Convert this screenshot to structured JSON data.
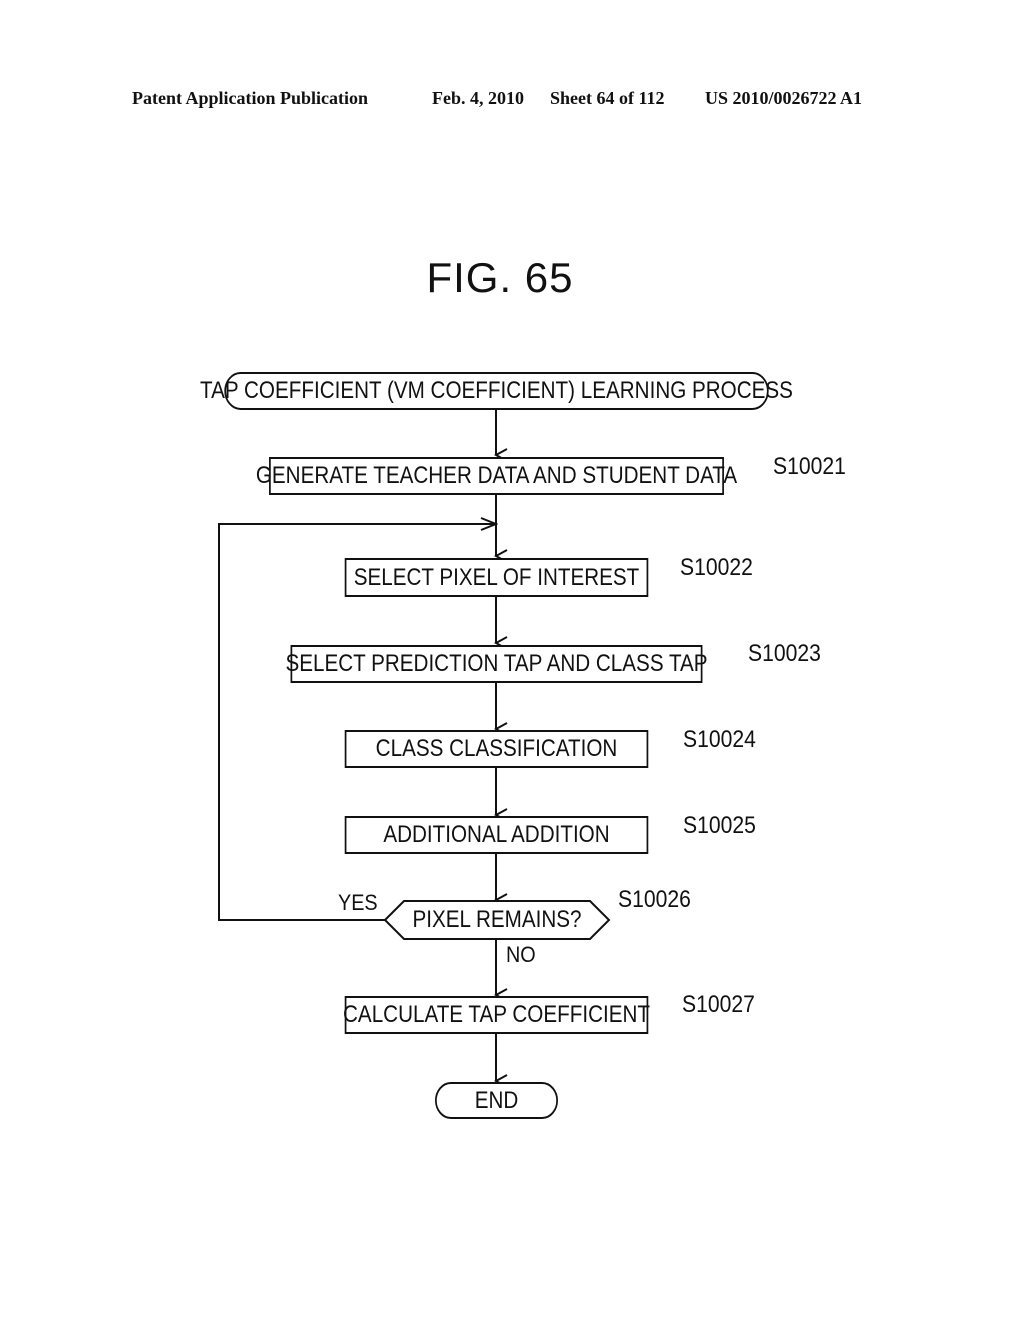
{
  "header": {
    "publication": "Patent Application Publication",
    "date": "Feb. 4, 2010",
    "sheet": "Sheet 64 of 112",
    "number": "US 2010/0026722 A1"
  },
  "figure": {
    "title": "FIG. 65",
    "start": "TAP COEFFICIENT (VM COEFFICIENT) LEARNING PROCESS",
    "end": "END",
    "steps": [
      {
        "id": "S10021",
        "text": "GENERATE TEACHER DATA AND STUDENT DATA"
      },
      {
        "id": "S10022",
        "text": "SELECT PIXEL OF INTEREST"
      },
      {
        "id": "S10023",
        "text": "SELECT PREDICTION TAP AND CLASS TAP"
      },
      {
        "id": "S10024",
        "text": "CLASS CLASSIFICATION"
      },
      {
        "id": "S10025",
        "text": "ADDITIONAL ADDITION"
      },
      {
        "id": "S10026",
        "text": "PIXEL REMAINS?"
      },
      {
        "id": "S10027",
        "text": "CALCULATE TAP COEFFICIENT"
      }
    ],
    "decision_yes": "YES",
    "decision_no": "NO"
  }
}
